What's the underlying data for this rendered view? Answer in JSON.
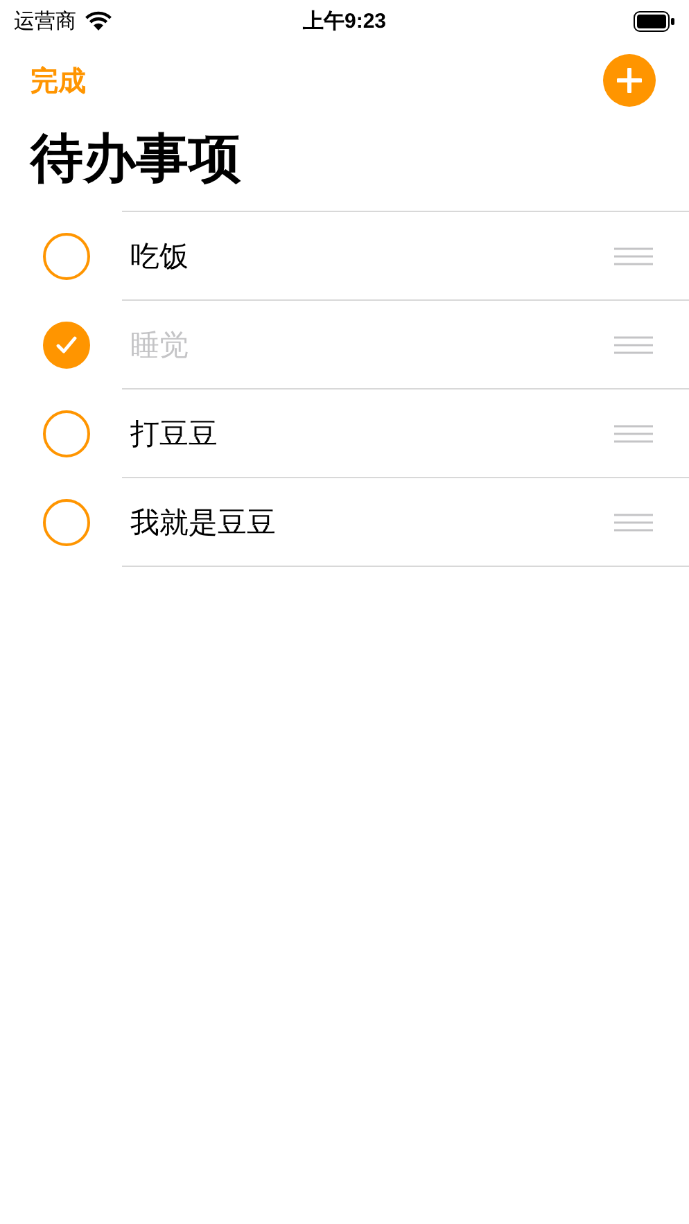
{
  "status_bar": {
    "carrier": "运营商",
    "time": "上午9:23"
  },
  "nav": {
    "done_button": "完成"
  },
  "title": "待办事项",
  "items": [
    {
      "text": "吃饭",
      "checked": false
    },
    {
      "text": "睡觉",
      "checked": true
    },
    {
      "text": "打豆豆",
      "checked": false
    },
    {
      "text": "我就是豆豆",
      "checked": false
    }
  ]
}
